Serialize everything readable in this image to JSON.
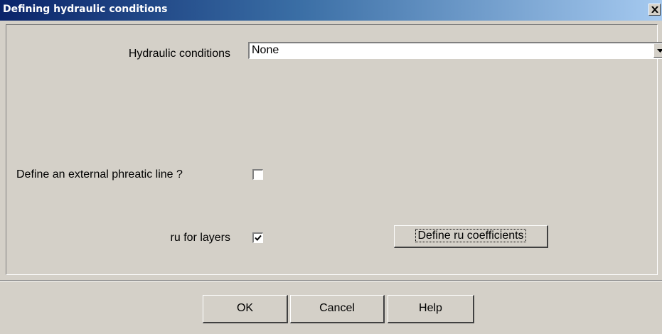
{
  "window": {
    "title": "Defining hydraulic conditions"
  },
  "form": {
    "hydraulic_label": "Hydraulic conditions",
    "hydraulic_value": "None",
    "phreatic_label": "Define an external phreatic line ?",
    "phreatic_checked": false,
    "ru_label": "ru for layers",
    "ru_checked": true,
    "define_ru_label": "Define ru coefficients"
  },
  "footer": {
    "ok_label": "OK",
    "cancel_label": "Cancel",
    "help_label": "Help"
  },
  "icons": {
    "close": "close-icon",
    "dropdown": "chevron-down-icon",
    "check": "checkmark-icon"
  },
  "colors": {
    "title_bar_start": "#0a246a",
    "title_bar_end": "#a6caf0",
    "dialog_background": "#d4d0c8"
  }
}
